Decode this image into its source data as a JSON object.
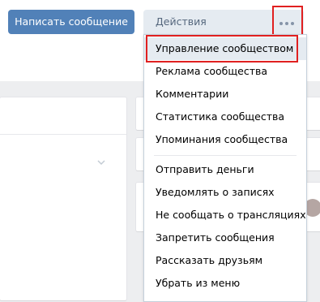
{
  "header": {
    "write_button_label": "Написать сообщение",
    "actions_button_label": "Действия",
    "more_icon": "more-horizontal-icon"
  },
  "dropdown": {
    "items": [
      "Управление сообществом",
      "Реклама сообщества",
      "Комментарии",
      "Статистика сообщества",
      "Упоминания сообщества",
      "Отправить деньги",
      "Уведомлять о записях",
      "Не сообщать о трансляциях",
      "Запретить сообщения",
      "Рассказать друзьям",
      "Убрать из меню"
    ],
    "highlighted_item": "Управление сообществом"
  },
  "colors": {
    "primary_button": "#5181b8",
    "secondary_button": "#e5ebf1",
    "highlight_outline": "#e02020",
    "page_background": "#edeef0"
  }
}
